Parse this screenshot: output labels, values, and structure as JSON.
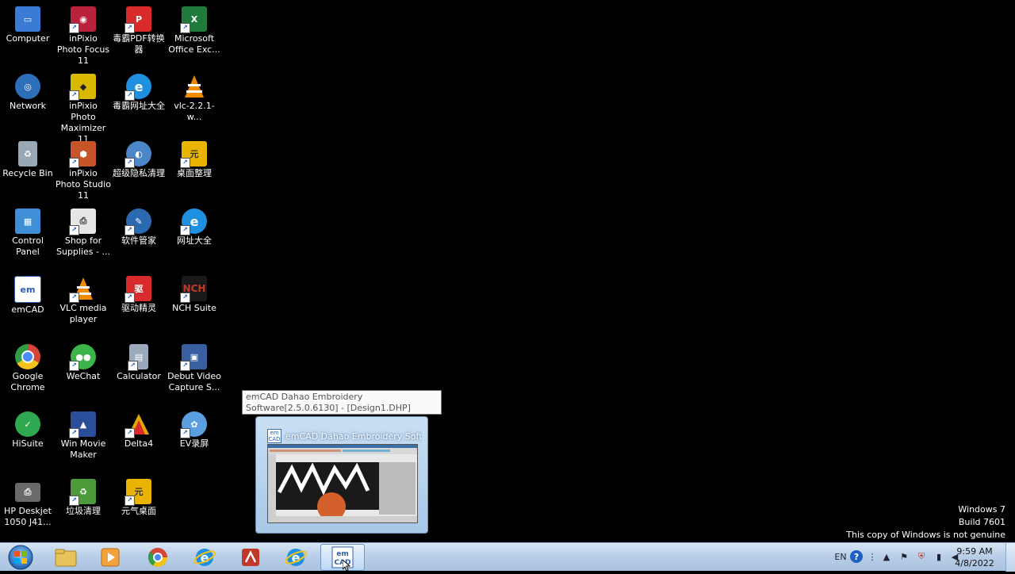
{
  "desktop_icons": [
    {
      "label": "Computer",
      "icon": "computer-icon",
      "color": "#3a7bd5"
    },
    {
      "label": "Network",
      "icon": "network-icon",
      "color": "#2d6fb8"
    },
    {
      "label": "Recycle Bin",
      "icon": "recycle-bin-icon",
      "color": "#9aa7b4"
    },
    {
      "label": "Control Panel",
      "icon": "control-panel-icon",
      "color": "#3f8fd8"
    },
    {
      "label": "emCAD",
      "icon": "emcad-icon",
      "color": "#2c5fa8"
    },
    {
      "label": "Google Chrome",
      "icon": "chrome-icon",
      "color": "#d64537"
    },
    {
      "label": "HiSuite",
      "icon": "hisuite-icon",
      "color": "#2fa84f"
    },
    {
      "label": "HP Deskjet 1050 J41...",
      "icon": "printer-icon",
      "color": "#6a6a6a"
    },
    {
      "label": "inPixio Photo Focus 11",
      "icon": "inpixio-focus-icon",
      "color": "#b8233b"
    },
    {
      "label": "inPixio Photo Maximizer 11",
      "icon": "inpixio-maximizer-icon",
      "color": "#d9b800"
    },
    {
      "label": "inPixio Photo Studio 11",
      "icon": "inpixio-studio-icon",
      "color": "#c8542a"
    },
    {
      "label": "Shop for Supplies - ...",
      "icon": "shop-supplies-icon",
      "color": "#e6e6e6"
    },
    {
      "label": "VLC media player",
      "icon": "vlc-icon",
      "color": "#f08a00"
    },
    {
      "label": "WeChat",
      "icon": "wechat-icon",
      "color": "#3bb54a"
    },
    {
      "label": "Win Movie Maker",
      "icon": "movie-maker-icon",
      "color": "#2a4f9a"
    },
    {
      "label": "垃圾清理",
      "icon": "cleaner-icon",
      "color": "#4c9a3a"
    },
    {
      "label": "毒霸PDF转换器",
      "icon": "pdf-converter-icon",
      "color": "#d92b2b"
    },
    {
      "label": "毒霸网址大全",
      "icon": "ie-icon",
      "color": "#1f8fe0"
    },
    {
      "label": "超级隐私清理",
      "icon": "privacy-clean-icon",
      "color": "#4a86c8"
    },
    {
      "label": "软件管家",
      "icon": "software-manager-icon",
      "color": "#2c6ab0"
    },
    {
      "label": "驱动精灵",
      "icon": "driver-icon",
      "color": "#d92b2b"
    },
    {
      "label": "Calculator",
      "icon": "calculator-icon",
      "color": "#9aa9bb"
    },
    {
      "label": "Delta4",
      "icon": "delta4-icon",
      "color": "#e0a800"
    },
    {
      "label": "元气桌面",
      "icon": "yuanqi-desktop-icon",
      "color": "#e8b400"
    },
    {
      "label": "Microsoft Office Exc...",
      "icon": "excel-icon",
      "color": "#1f7a3c"
    },
    {
      "label": "vlc-2.2.1-w...",
      "icon": "vlc-icon",
      "color": "#f08a00"
    },
    {
      "label": "桌面整理",
      "icon": "desktop-organize-icon",
      "color": "#e8b400"
    },
    {
      "label": "网址大全",
      "icon": "ie-icon",
      "color": "#1f8fe0"
    },
    {
      "label": "NCH Suite",
      "icon": "nch-icon",
      "color": "#c0392b"
    },
    {
      "label": "Debut Video Capture S...",
      "icon": "debut-icon",
      "color": "#3a5fa0"
    },
    {
      "label": "EV录屏",
      "icon": "ev-recorder-icon",
      "color": "#5aa0e0"
    }
  ],
  "tooltip": {
    "text": "emCAD Dahao Embroidery Software[2.5.0.6130] - [Design1.DHP]"
  },
  "thumbnail": {
    "title": "emCAD Dahao Embroidery Soft..."
  },
  "watermark": {
    "line1": "Windows 7",
    "line2": "Build 7601",
    "line3": "This copy of Windows is not genuine"
  },
  "taskbar": {
    "buttons": [
      {
        "name": "explorer",
        "icon": "folder-icon"
      },
      {
        "name": "media",
        "icon": "media-player-icon"
      },
      {
        "name": "chrome",
        "icon": "chrome-icon"
      },
      {
        "name": "ie",
        "icon": "ie-icon"
      },
      {
        "name": "kingsoft",
        "icon": "kingsoft-icon"
      },
      {
        "name": "ie2",
        "icon": "ie-icon"
      },
      {
        "name": "emcad",
        "icon": "emcad-icon"
      }
    ],
    "language": "EN",
    "time": "9:59 AM",
    "date": "4/8/2022"
  }
}
